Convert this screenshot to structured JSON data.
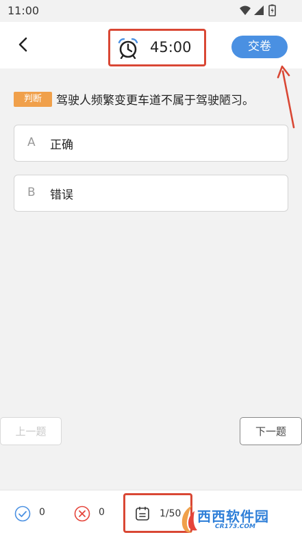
{
  "status_bar": {
    "time": "11:00",
    "icons": [
      "wifi-icon",
      "signal-icon",
      "battery-charging-icon"
    ]
  },
  "header": {
    "back_icon": "chevron-left-icon",
    "timer_icon": "alarm-clock-icon",
    "timer": "45:00",
    "submit_label": "交卷"
  },
  "question": {
    "type_label": "判断",
    "text": "驾驶人频繁变更车道不属于驾驶陋习。"
  },
  "options": [
    {
      "letter": "A",
      "text": "正确"
    },
    {
      "letter": "B",
      "text": "错误"
    }
  ],
  "navigation": {
    "prev_label": "上一题",
    "next_label": "下一题"
  },
  "bottom_bar": {
    "correct_count": "0",
    "wrong_count": "0",
    "progress": "1/50"
  },
  "watermark": {
    "title": "西西软件园",
    "subtitle": "CR173.COM"
  },
  "colors": {
    "accent_blue": "#4a90e2",
    "badge_orange": "#f0a04b",
    "annotation_red": "#d94734",
    "wrong_red": "#e5443a"
  }
}
